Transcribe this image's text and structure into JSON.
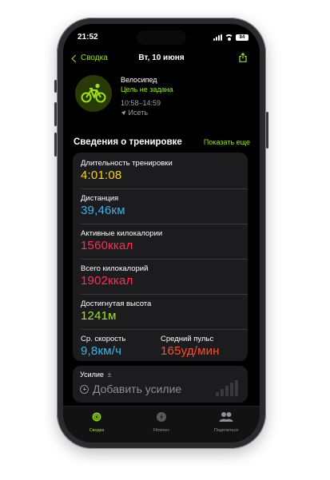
{
  "status": {
    "time": "21:52",
    "battery": "84"
  },
  "nav": {
    "back_label": "Сводка",
    "title": "Вт, 10 июня"
  },
  "workout": {
    "type": "Велосипед",
    "goal": "Цель не задана",
    "time_range": "10:58–14:59",
    "location": "Исеть"
  },
  "section": {
    "title": "Сведения о тренировке",
    "show_more": "Показать еще"
  },
  "metrics": [
    {
      "label": "Длительность тренировки",
      "value": "4:01:08"
    },
    {
      "label": "Дистанция",
      "value": "39,46км"
    },
    {
      "label": "Активные килокалории",
      "value": "1560ккал"
    },
    {
      "label": "Всего килокалорий",
      "value": "1902ккал"
    },
    {
      "label": "Достигнутая высота",
      "value": "1241м"
    },
    {
      "label": "Ср. скорость",
      "value": "9,8км/ч"
    },
    {
      "label": "Средний пульс",
      "value": "165уд/мин"
    }
  ],
  "effort": {
    "label": "Усилие",
    "info_symbol": "±",
    "add_label": "Добавить усилие"
  },
  "tabs": [
    {
      "label": "Сводка",
      "icon": "activity-rings-icon"
    },
    {
      "label": "Fitness+",
      "icon": "fitness-plus-icon"
    },
    {
      "label": "Поделиться",
      "icon": "people-icon"
    }
  ],
  "colors": {
    "accent": "#9de21a",
    "duration": "#f5d21f",
    "distance": "#3bb3e8",
    "calories": "#ff2d55",
    "elevation": "#9de21a",
    "heart_rate": "#ff4d2e"
  }
}
